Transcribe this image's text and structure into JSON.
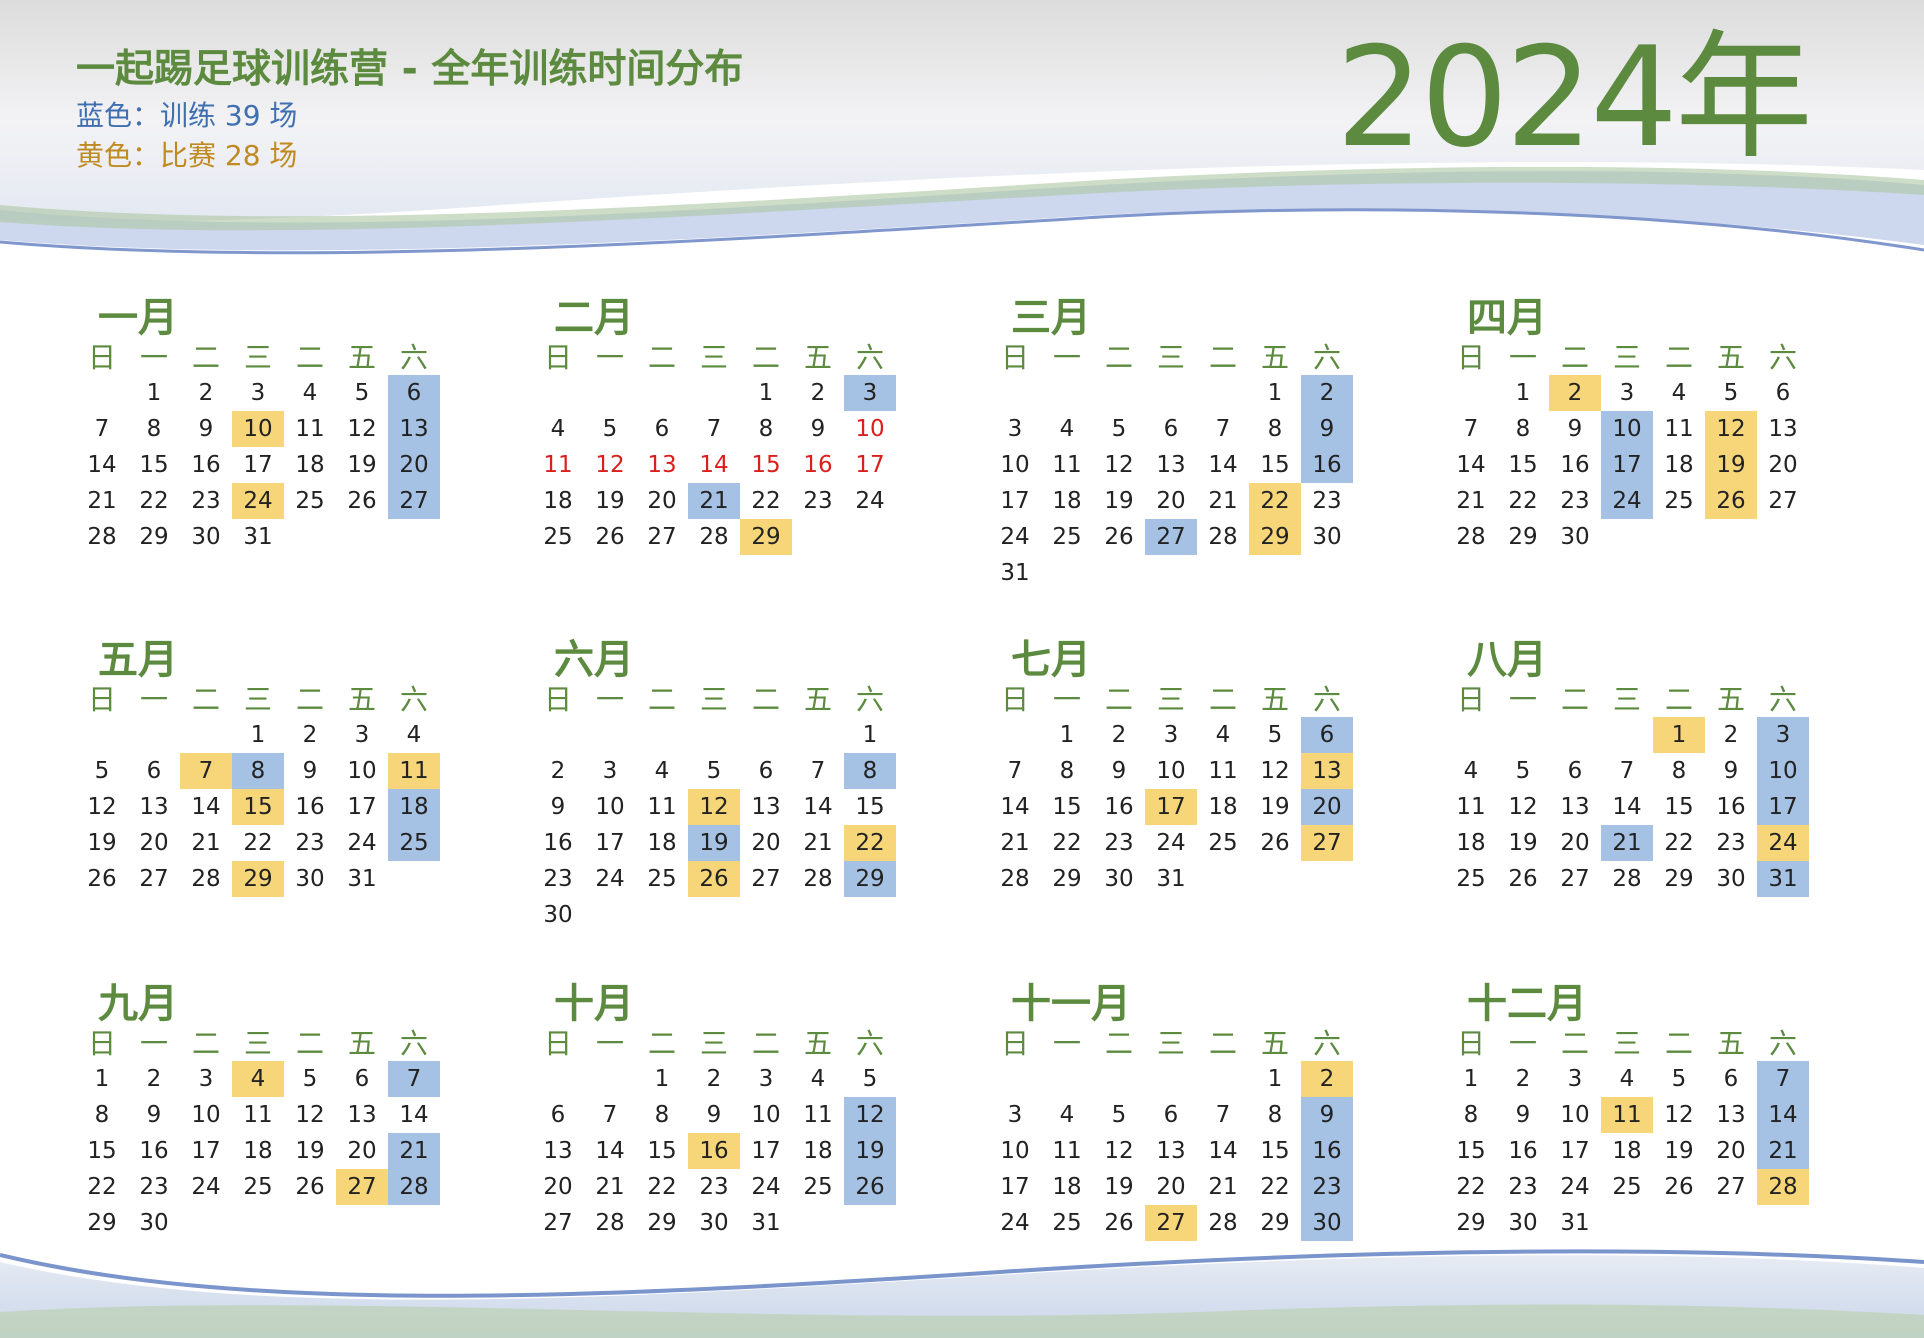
{
  "header": {
    "title": "一起踢足球训练营 - 全年训练时间分布",
    "legend_training": "蓝色：训练 39 场",
    "legend_match": "黄色：比赛 28 场",
    "year": "2024年"
  },
  "colors": {
    "accent_green": "#5c8a3f",
    "training_blue": "#a5c1e3",
    "match_yellow": "#f7d679",
    "holiday_red": "#d9201d"
  },
  "months": [
    {
      "name": "一月",
      "weekdays": [
        "日",
        "一",
        "二",
        "三",
        "二",
        "五",
        "六"
      ],
      "start": 1,
      "days": 31,
      "training": [
        6,
        13,
        20,
        27
      ],
      "match": [
        10,
        24
      ],
      "holiday": []
    },
    {
      "name": "二月",
      "weekdays": [
        "日",
        "一",
        "二",
        "三",
        "二",
        "五",
        "六"
      ],
      "start": 4,
      "days": 29,
      "training": [
        3,
        21
      ],
      "match": [
        29
      ],
      "holiday": [
        10,
        11,
        12,
        13,
        14,
        15,
        16,
        17
      ]
    },
    {
      "name": "三月",
      "weekdays": [
        "日",
        "一",
        "二",
        "三",
        "二",
        "五",
        "六"
      ],
      "start": 5,
      "days": 31,
      "training": [
        2,
        9,
        16,
        27
      ],
      "match": [
        22,
        29
      ],
      "holiday": []
    },
    {
      "name": "四月",
      "weekdays": [
        "日",
        "一",
        "二",
        "三",
        "二",
        "五",
        "六"
      ],
      "start": 1,
      "days": 30,
      "training": [
        10,
        17,
        24
      ],
      "match": [
        2,
        12,
        19,
        26
      ],
      "holiday": []
    },
    {
      "name": "五月",
      "weekdays": [
        "日",
        "一",
        "二",
        "三",
        "二",
        "五",
        "六"
      ],
      "start": 3,
      "days": 31,
      "training": [
        8,
        18,
        25
      ],
      "match": [
        7,
        11,
        15,
        29
      ],
      "holiday": []
    },
    {
      "name": "六月",
      "weekdays": [
        "日",
        "一",
        "二",
        "三",
        "二",
        "五",
        "六"
      ],
      "start": 6,
      "days": 30,
      "training": [
        8,
        19,
        29
      ],
      "match": [
        12,
        22,
        26
      ],
      "holiday": []
    },
    {
      "name": "七月",
      "weekdays": [
        "日",
        "一",
        "二",
        "三",
        "二",
        "五",
        "六"
      ],
      "start": 1,
      "days": 31,
      "training": [
        6,
        20
      ],
      "match": [
        13,
        17,
        27
      ],
      "holiday": []
    },
    {
      "name": "八月",
      "weekdays": [
        "日",
        "一",
        "二",
        "三",
        "二",
        "五",
        "六"
      ],
      "start": 4,
      "days": 31,
      "training": [
        3,
        10,
        17,
        21,
        31
      ],
      "match": [
        1,
        24
      ],
      "holiday": []
    },
    {
      "name": "九月",
      "weekdays": [
        "日",
        "一",
        "二",
        "三",
        "二",
        "五",
        "六"
      ],
      "start": 0,
      "days": 30,
      "training": [
        7,
        21,
        28
      ],
      "match": [
        4,
        27
      ],
      "holiday": []
    },
    {
      "name": "十月",
      "weekdays": [
        "日",
        "一",
        "二",
        "三",
        "二",
        "五",
        "六"
      ],
      "start": 2,
      "days": 31,
      "training": [
        12,
        19,
        26
      ],
      "match": [
        16
      ],
      "holiday": []
    },
    {
      "name": "十一月",
      "weekdays": [
        "日",
        "一",
        "二",
        "三",
        "二",
        "五",
        "六"
      ],
      "start": 5,
      "days": 30,
      "training": [
        9,
        16,
        23,
        30
      ],
      "match": [
        2,
        27
      ],
      "holiday": []
    },
    {
      "name": "十二月",
      "weekdays": [
        "日",
        "一",
        "二",
        "三",
        "二",
        "五",
        "六"
      ],
      "start": 0,
      "days": 31,
      "training": [
        7,
        14,
        21
      ],
      "match": [
        11,
        28
      ],
      "holiday": []
    }
  ]
}
